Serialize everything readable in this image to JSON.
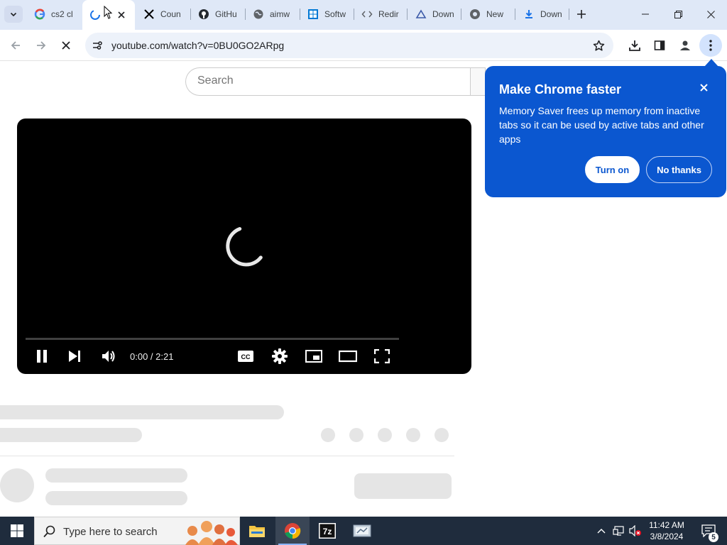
{
  "browser": {
    "tabs": [
      {
        "title": "cs2 cl",
        "icon": "google-icon"
      },
      {
        "title": "",
        "icon": "loading-icon",
        "active": true
      },
      {
        "title": "Coun",
        "icon": "x-icon"
      },
      {
        "title": "GitHu",
        "icon": "github-icon"
      },
      {
        "title": "aimw",
        "icon": "globe-icon"
      },
      {
        "title": "Softw",
        "icon": "windows-icon"
      },
      {
        "title": "Redir",
        "icon": "code-icon"
      },
      {
        "title": "Down",
        "icon": "triangle-icon"
      },
      {
        "title": "New",
        "icon": "chrome-icon"
      },
      {
        "title": "Down",
        "icon": "download-icon"
      }
    ],
    "url": "youtube.com/watch?v=0BU0GO2ARpg"
  },
  "page": {
    "search_placeholder": "Search",
    "player": {
      "time": "0:00 / 2:21",
      "progress": 0.0
    }
  },
  "popup": {
    "title": "Make Chrome faster",
    "body": "Memory Saver frees up memory from inactive tabs so it can be used by active tabs and other apps",
    "turn_on_label": "Turn on",
    "no_thanks_label": "No thanks"
  },
  "taskbar": {
    "search_placeholder": "Type here to search",
    "time": "11:42 AM",
    "date": "3/8/2024",
    "notification_count": "5"
  },
  "colors": {
    "accent": "#0b57d0",
    "tabstrip": "#dfe8f7",
    "taskbar": "#1f2c3d"
  }
}
